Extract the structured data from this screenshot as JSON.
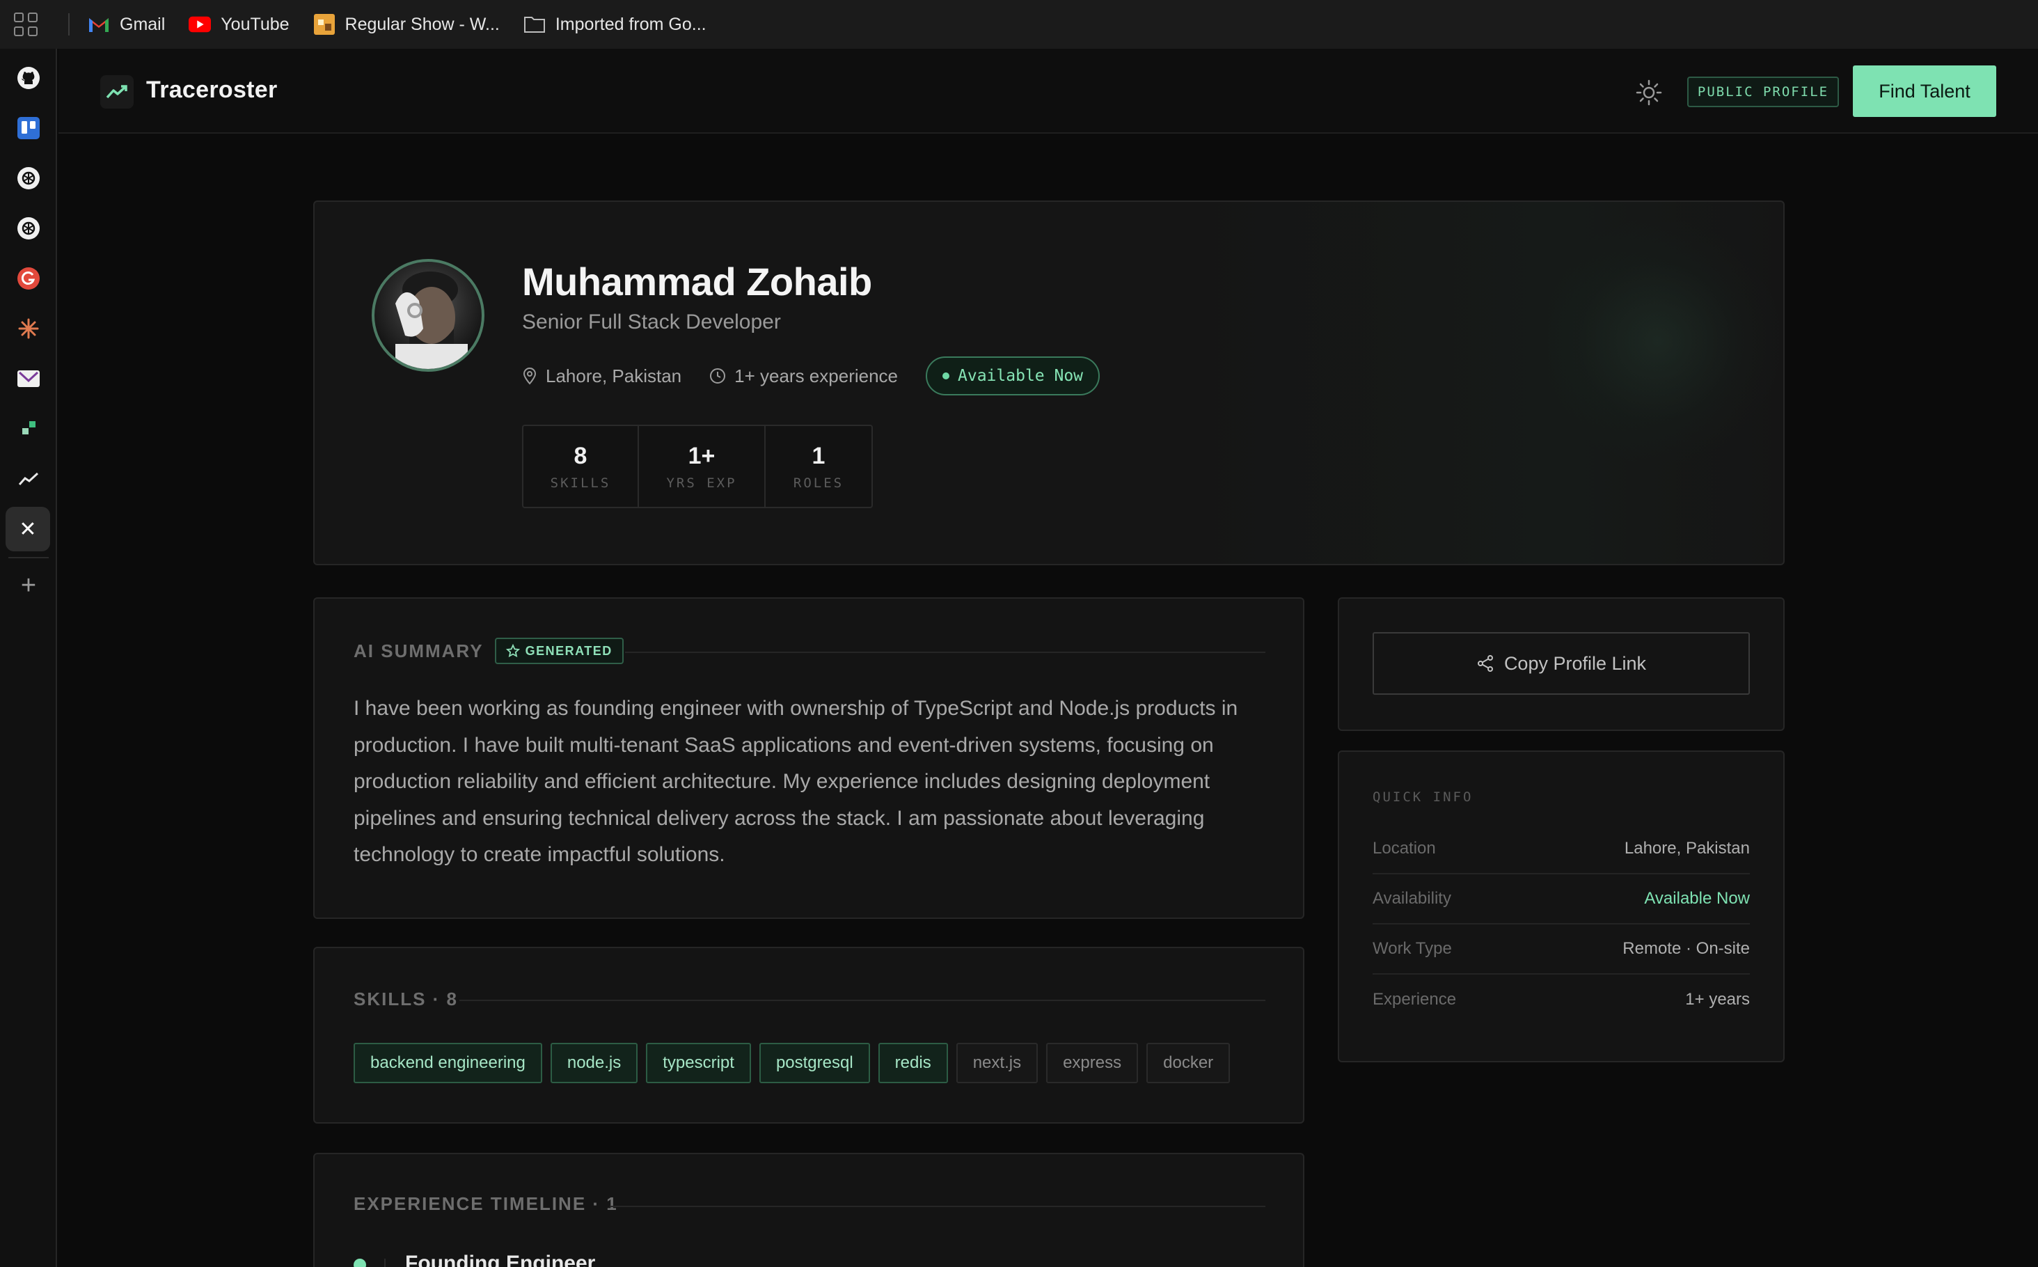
{
  "bookmarks": [
    {
      "label": "Gmail",
      "icon": "gmail-icon"
    },
    {
      "label": "YouTube",
      "icon": "youtube-icon"
    },
    {
      "label": "Regular Show - W...",
      "icon": "regular-show-icon"
    },
    {
      "label": "Imported from Go...",
      "icon": "folder-icon"
    }
  ],
  "header": {
    "brand": "Traceroster",
    "public_profile": "PUBLIC PROFILE",
    "find_talent": "Find Talent"
  },
  "profile": {
    "name": "Muhammad Zohaib",
    "title": "Senior Full Stack Developer",
    "location": "Lahore, Pakistan",
    "experience": "1+ years experience",
    "availability": "Available Now",
    "stats": [
      {
        "value": "8",
        "label": "SKILLS"
      },
      {
        "value": "1+",
        "label": "YRS EXP"
      },
      {
        "value": "1",
        "label": "ROLES"
      }
    ]
  },
  "summary": {
    "label": "AI SUMMARY",
    "badge": "GENERATED",
    "text": "I have been working as founding engineer with ownership of TypeScript and Node.js products in production. I have built multi-tenant SaaS applications and event-driven systems, focusing on production reliability and efficient architecture. My experience includes designing deployment pipelines and ensuring technical delivery across the stack. I am passionate about leveraging technology to create impactful solutions."
  },
  "skills": {
    "label": "SKILLS · 8",
    "items": [
      {
        "name": "backend engineering",
        "primary": true
      },
      {
        "name": "node.js",
        "primary": true
      },
      {
        "name": "typescript",
        "primary": true
      },
      {
        "name": "postgresql",
        "primary": true
      },
      {
        "name": "redis",
        "primary": true
      },
      {
        "name": "next.js",
        "primary": false
      },
      {
        "name": "express",
        "primary": false
      },
      {
        "name": "docker",
        "primary": false
      }
    ]
  },
  "experience": {
    "label": "EXPERIENCE TIMELINE · 1",
    "items": [
      {
        "role": "Founding Engineer"
      }
    ]
  },
  "copy_link": "Copy Profile Link",
  "quick_info": {
    "label": "QUICK INFO",
    "rows": [
      {
        "key": "Location",
        "value": "Lahore, Pakistan"
      },
      {
        "key": "Availability",
        "value": "Available Now"
      },
      {
        "key": "Work Type",
        "value": "Remote · On-site"
      },
      {
        "key": "Experience",
        "value": "1+ years"
      }
    ]
  },
  "colors": {
    "accent": "#7ee2b2",
    "background": "#0b0b0b",
    "card": "#141414"
  }
}
